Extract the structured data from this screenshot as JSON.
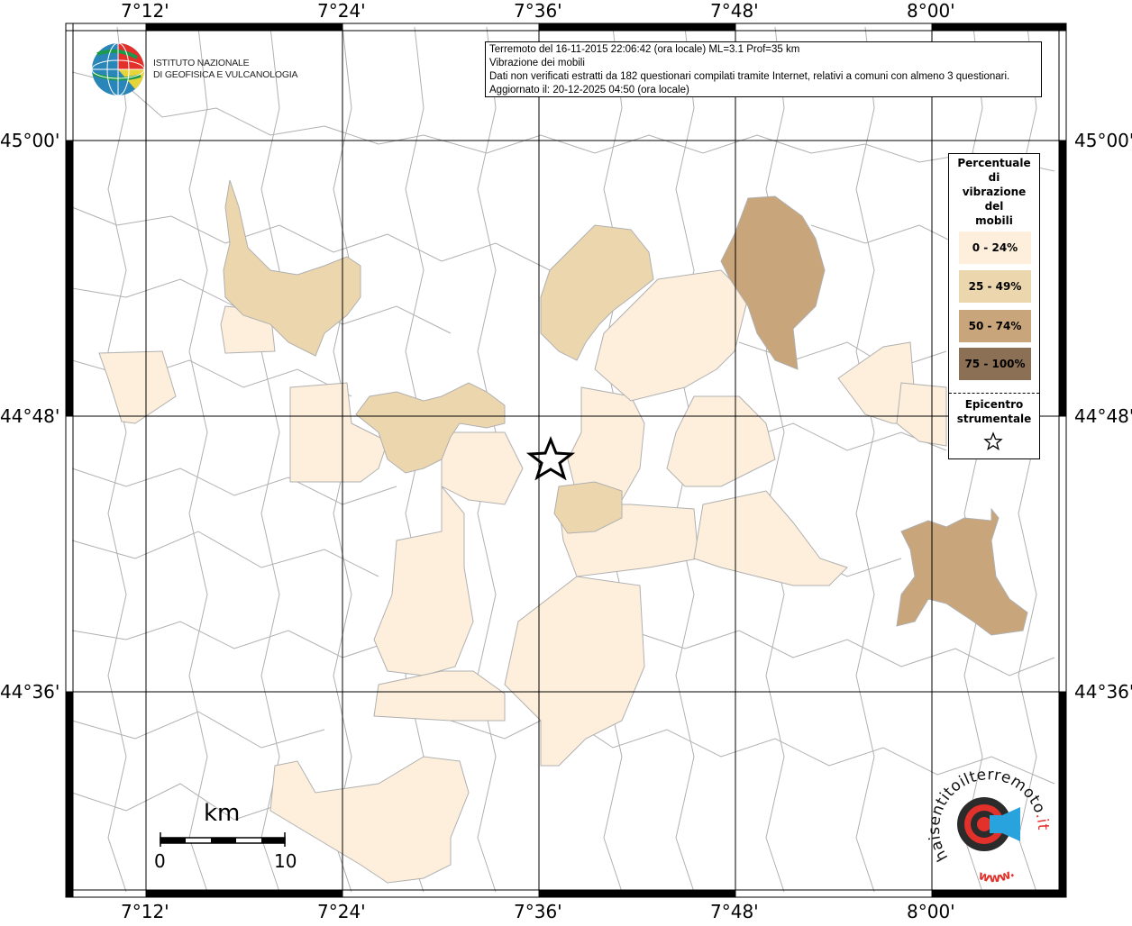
{
  "header": {
    "line1": "Terremoto del 16-11-2015 22:06:42 (ora locale) ML=3.1 Prof=35 km",
    "line2": "Vibrazione dei mobili",
    "line3": "Dati non verificati estratti da 182 questionari compilati tramite Internet, relativi a comuni con almeno 3 questionari.",
    "line4": "Aggiornato il: 20-12-2025 04:50 (ora locale)"
  },
  "logo_ingv": {
    "line1": "ISTITUTO NAZIONALE",
    "line2": "DI GEOFISICA E VULCANOLOGIA"
  },
  "axes": {
    "top_lon": [
      "7°12'",
      "7°24'",
      "7°36'",
      "7°48'",
      "8°00'"
    ],
    "bottom_lon": [
      "7°12'",
      "7°24'",
      "7°36'",
      "7°48'",
      "8°00'"
    ],
    "left_lat": [
      "45°00'",
      "44°48'",
      "44°36'"
    ],
    "right_lat": [
      "45°00'",
      "44°48'",
      "44°36'"
    ]
  },
  "legend": {
    "title_lines": [
      "Percentuale",
      "di",
      "vibrazione",
      "del",
      "mobili"
    ],
    "classes": [
      {
        "label": "0 - 24%",
        "color": "#fdefdc"
      },
      {
        "label": "25 - 49%",
        "color": "#ecd6ae"
      },
      {
        "label": "50 - 74%",
        "color": "#c8a57a"
      },
      {
        "label": "75 - 100%",
        "color": "#8b7055"
      }
    ],
    "epicentre_line1": "Epicentro",
    "epicentre_line2": "strumentale",
    "epicentre_icon": "star-icon"
  },
  "scale_bar": {
    "unit": "km",
    "min_label": "0",
    "max_label": "10"
  },
  "hsit_logo": {
    "text": "haisentitoilterremoto",
    "text_highlight": ".it",
    "url_text": "www.",
    "icon": "speaker-icon"
  },
  "colors": {
    "class_0": "#fdefdc",
    "class_1": "#ecd6ae",
    "class_2": "#c8a57a",
    "class_3": "#8b7055",
    "boundary": "#aaaaaa",
    "grid": "#000000"
  }
}
